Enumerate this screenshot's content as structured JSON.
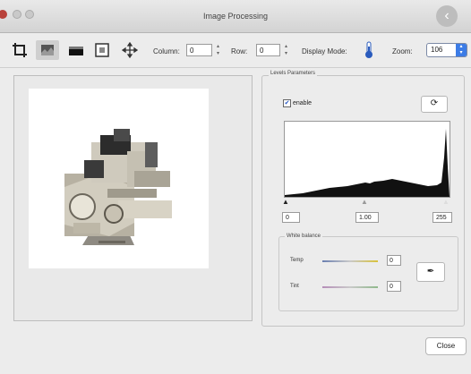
{
  "window": {
    "title": "Image Processing"
  },
  "toolbar": {
    "column_label": "Column:",
    "column_value": "0",
    "row_label": "Row:",
    "row_value": "0",
    "display_mode_label": "Display Mode:",
    "zoom_label": "Zoom:",
    "zoom_value": "106"
  },
  "levels": {
    "group_label": "Levels Parameters",
    "enable_label": "enable",
    "enable_checked": true,
    "black_value": "0",
    "gamma_value": "1.00",
    "white_value": "255"
  },
  "white_balance": {
    "group_label": "White balance",
    "temp_label": "Temp",
    "temp_value": "0",
    "tint_label": "Tint",
    "tint_value": "0"
  },
  "footer": {
    "close_label": "Close"
  },
  "icons": [
    "crop-icon",
    "filter-icon",
    "layer-icon",
    "frame-icon",
    "move-icon",
    "display-mode-icon",
    "reset-icon",
    "eyedropper-icon",
    "back-icon"
  ]
}
